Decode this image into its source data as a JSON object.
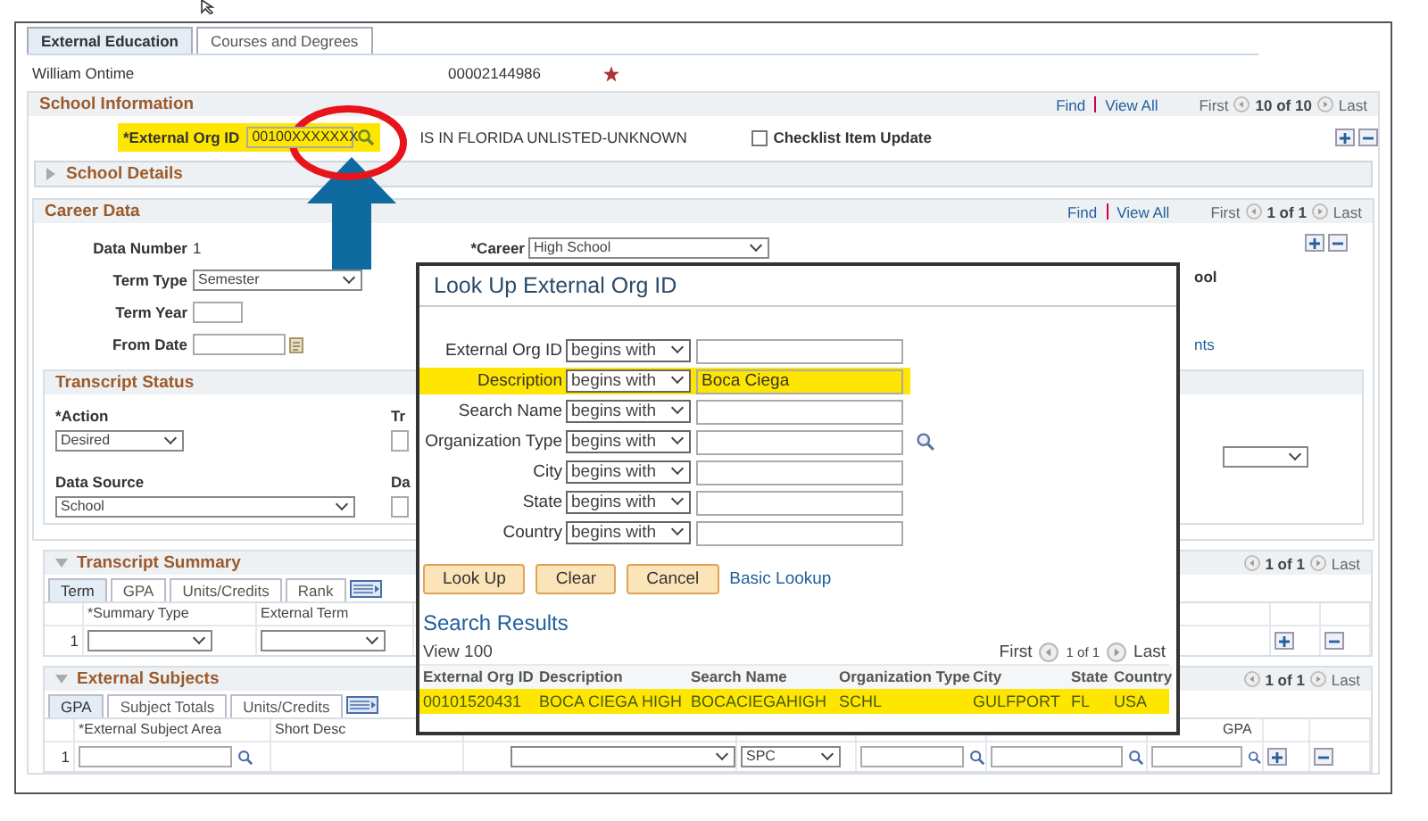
{
  "tabs": [
    {
      "label": "External Education",
      "selected": true
    },
    {
      "label": "Courses and Degrees",
      "selected": false
    }
  ],
  "person": {
    "name": "William Ontime",
    "id": "00002144986"
  },
  "school_information": {
    "title": "School Information",
    "find": "Find",
    "view_all": "View All",
    "first": "First",
    "count": "10 of 10",
    "last": "Last",
    "org_id": {
      "label": "*External Org ID",
      "value": "00100XXXXXXX",
      "highlighted": true
    },
    "org_description": "IS IN FLORIDA UNLISTED-UNKNOWN",
    "checklist": {
      "label": "Checklist Item Update",
      "checked": false
    },
    "school_details": {
      "label": "School Details",
      "expanded": false
    }
  },
  "career_data": {
    "title": "Career Data",
    "find": "Find",
    "view_all": "View All",
    "first": "First",
    "count": "1 of 1",
    "last": "Last",
    "data_number_label": "Data Number",
    "data_number": "1",
    "career_label": "*Career",
    "career_value": "High School",
    "term_type_label": "Term Type",
    "term_type_value": "Semester",
    "term_year_label": "Term Year",
    "from_date_label": "From Date",
    "fragment_1": "ool",
    "fragment_2": "nts"
  },
  "transcript_status": {
    "title": "Transcript Status",
    "action_label": "*Action",
    "action_value": "Desired",
    "data_source_label": "Data Source",
    "data_source_value": "School",
    "fragment_1": "Tr",
    "fragment_2": "Da"
  },
  "transcript_summary": {
    "title": "Transcript Summary",
    "count": "1 of 1",
    "last": "Last",
    "tabs": [
      {
        "label": "Term",
        "selected": true
      },
      {
        "label": "GPA",
        "selected": false
      },
      {
        "label": "Units/Credits",
        "selected": false
      },
      {
        "label": "Rank",
        "selected": false
      }
    ],
    "columns": [
      "*Summary Type",
      "External Term"
    ],
    "row_number": "1"
  },
  "external_subjects": {
    "title": "External Subjects",
    "count": "1 of 1",
    "last": "Last",
    "tabs": [
      {
        "label": "GPA",
        "selected": true
      },
      {
        "label": "Subject Totals",
        "selected": false
      },
      {
        "label": "Units/Credits",
        "selected": false
      }
    ],
    "columns": [
      "*External Subject Area",
      "Short Desc"
    ],
    "column_gpa": "GPA",
    "row_number": "1",
    "select_value": "SPC"
  },
  "dialog": {
    "title": "Look Up External Org ID",
    "criteria": [
      {
        "label": "External Org ID",
        "operator": "begins with",
        "highlighted": false,
        "lookup": false
      },
      {
        "label": "Description",
        "operator": "begins with",
        "value": "Boca Ciega",
        "highlighted": true,
        "lookup": false
      },
      {
        "label": "Search Name",
        "operator": "begins with",
        "highlighted": false,
        "lookup": false
      },
      {
        "label": "Organization Type",
        "operator": "begins with",
        "highlighted": false,
        "lookup": true
      },
      {
        "label": "City",
        "operator": "begins with",
        "highlighted": false,
        "lookup": false
      },
      {
        "label": "State",
        "operator": "begins with",
        "highlighted": false,
        "lookup": false
      },
      {
        "label": "Country",
        "operator": "begins with",
        "highlighted": false,
        "lookup": false
      }
    ],
    "buttons": [
      "Look Up",
      "Clear",
      "Cancel"
    ],
    "link": "Basic Lookup",
    "results_title": "Search Results",
    "view": "View 100",
    "first": "First",
    "count": "1 of 1",
    "last": "Last",
    "columns": [
      "External Org ID",
      "Description",
      "Search Name",
      "Organization Type",
      "City",
      "State",
      "Country"
    ],
    "rows": [
      {
        "cells": [
          "00101520431",
          "BOCA CIEGA HIGH",
          "BOCACIEGAHIGH",
          "SCHL",
          "GULFPORT",
          "FL",
          "USA"
        ],
        "highlighted": true
      }
    ]
  }
}
